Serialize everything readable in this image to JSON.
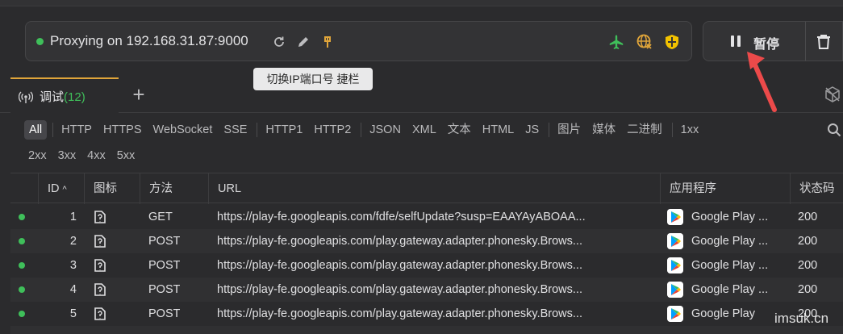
{
  "proxy": {
    "status_text": "Proxying on 192.168.31.87:9000",
    "icons": [
      "refresh-icon",
      "edit-icon",
      "pin-icon",
      "airplane-icon",
      "globe-icon",
      "shield-icon"
    ]
  },
  "controls": {
    "pause_label": "暂停",
    "tooltip": "切换IP端口号 捷栏"
  },
  "tabs": [
    {
      "label": "调试",
      "count": "(12)"
    }
  ],
  "filters": {
    "row1": [
      "All",
      "HTTP",
      "HTTPS",
      "WebSocket",
      "SSE",
      "HTTP1",
      "HTTP2",
      "JSON",
      "XML",
      "文本",
      "HTML",
      "JS",
      "图片",
      "媒体",
      "二进制",
      "1xx"
    ],
    "row2": [
      "2xx",
      "3xx",
      "4xx",
      "5xx"
    ]
  },
  "table": {
    "columns": {
      "id": "ID",
      "icon": "图标",
      "method": "方法",
      "url": "URL",
      "app": "应用程序",
      "status": "状态码"
    },
    "rows": [
      {
        "id": "1",
        "method": "GET",
        "url": "https://play-fe.googleapis.com/fdfe/selfUpdate?susp=EAAYAyABOAA...",
        "app": "Google Play ...",
        "status": "200"
      },
      {
        "id": "2",
        "method": "POST",
        "url": "https://play-fe.googleapis.com/play.gateway.adapter.phonesky.Brows...",
        "app": "Google Play ...",
        "status": "200"
      },
      {
        "id": "3",
        "method": "POST",
        "url": "https://play-fe.googleapis.com/play.gateway.adapter.phonesky.Brows...",
        "app": "Google Play ...",
        "status": "200"
      },
      {
        "id": "4",
        "method": "POST",
        "url": "https://play-fe.googleapis.com/play.gateway.adapter.phonesky.Brows...",
        "app": "Google Play ...",
        "status": "200"
      },
      {
        "id": "5",
        "method": "POST",
        "url": "https://play-fe.googleapis.com/play.gateway.adapter.phonesky.Brows...",
        "app": "Google Play",
        "status": "200"
      }
    ]
  },
  "watermark": "imsuk.cn",
  "colors": {
    "accent": "#e0a53a",
    "green": "#3fbf5a",
    "arrow": "#ec4a4a"
  }
}
